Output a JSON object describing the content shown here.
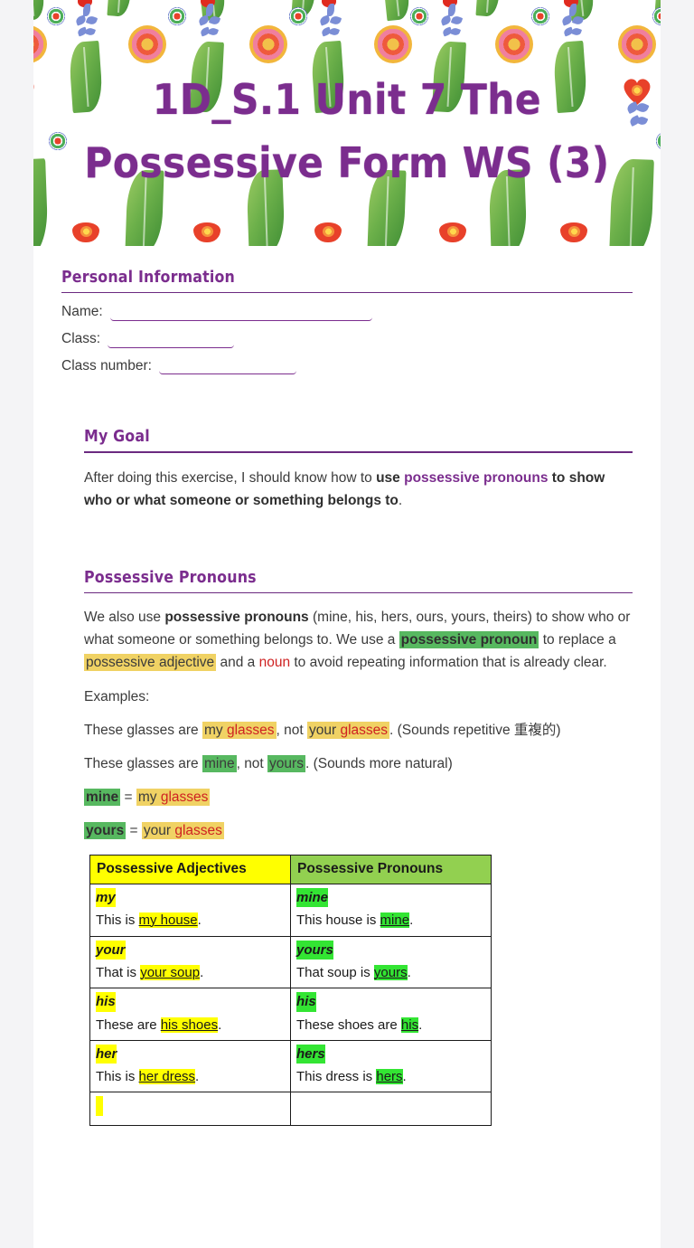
{
  "document": {
    "title": "1D_S.1 Unit 7 The Possessive Form WS (3)",
    "accent_purple": "#7b2d8e",
    "highlight_green": "#57b860",
    "highlight_amber": "#f0d264",
    "table_header_yellow": "#ffff00",
    "table_header_green": "#92d050",
    "cell_yellow": "#ffff00",
    "cell_green": "#33e533",
    "noun_red": "#cf2222"
  },
  "personal_information": {
    "heading": "Personal Information",
    "fields": [
      {
        "label": "Name:",
        "value": ""
      },
      {
        "label": "Class:",
        "value": ""
      },
      {
        "label": "Class number:",
        "value": ""
      }
    ]
  },
  "my_goal": {
    "heading": "My Goal",
    "text_parts": {
      "lead": "After doing this exercise, I should know how to ",
      "bold_use": "use ",
      "purple_phrase": "possessive pronouns",
      "bold_tail": " to show who or what someone or something belongs to",
      "period": "."
    }
  },
  "possessive_pronouns": {
    "heading": "Possessive Pronouns",
    "intro": {
      "p1_a": "We also use ",
      "p1_bold": "possessive pronouns",
      "p1_b": " (mine, his, hers, ours, yours, theirs) to show who or what someone or something belongs to. We use a ",
      "p1_green_bold": "possessive pronoun",
      "p1_c": " to replace a ",
      "p1_amber": "possessive adjective",
      "p1_d": " and a ",
      "p1_red": "noun",
      "p1_e": " to avoid repeating information that is already clear."
    },
    "examples_label": "Examples:",
    "example_1": {
      "a": "These glasses are ",
      "h1_adj": "my",
      "h1_noun": "glasses",
      "b": ", not ",
      "h2_adj": "your",
      "h2_noun": "glasses",
      "c": ". (Sounds repetitive 重複的)"
    },
    "example_2": {
      "a": "These glasses are ",
      "g1": "mine",
      "b": ", not ",
      "g2": "yours",
      "c": ". (Sounds more natural)"
    },
    "equation_1": {
      "left": "mine",
      "eq": " = ",
      "adj": "my",
      "noun": "glasses"
    },
    "equation_2": {
      "left": "yours",
      "eq": " = ",
      "adj": "your",
      "noun": "glasses"
    }
  },
  "comparison_table": {
    "headers": [
      "Possessive Adjectives",
      "Possessive Pronouns"
    ],
    "rows": [
      {
        "adjective_word": "my",
        "adjective_sentence_pre": "This is ",
        "adjective_sentence_hl": "my house",
        "adjective_sentence_post": ".",
        "pronoun_word": "mine",
        "pronoun_sentence_pre": "This house is ",
        "pronoun_sentence_hl": "mine",
        "pronoun_sentence_post": "."
      },
      {
        "adjective_word": "your",
        "adjective_sentence_pre": "That is ",
        "adjective_sentence_hl": "your soup",
        "adjective_sentence_post": ".",
        "pronoun_word": "yours",
        "pronoun_sentence_pre": "That soup is ",
        "pronoun_sentence_hl": "yours",
        "pronoun_sentence_post": "."
      },
      {
        "adjective_word": "his",
        "adjective_sentence_pre": "These are ",
        "adjective_sentence_hl": "his shoes",
        "adjective_sentence_post": ".",
        "pronoun_word": "his",
        "pronoun_sentence_pre": "These shoes are ",
        "pronoun_sentence_hl": "his",
        "pronoun_sentence_post": "."
      },
      {
        "adjective_word": "her",
        "adjective_sentence_pre": "This is ",
        "adjective_sentence_hl": "her dress",
        "adjective_sentence_post": ".",
        "pronoun_word": "hers",
        "pronoun_sentence_pre": "This dress is ",
        "pronoun_sentence_hl": "hers",
        "pronoun_sentence_post": "."
      }
    ]
  }
}
